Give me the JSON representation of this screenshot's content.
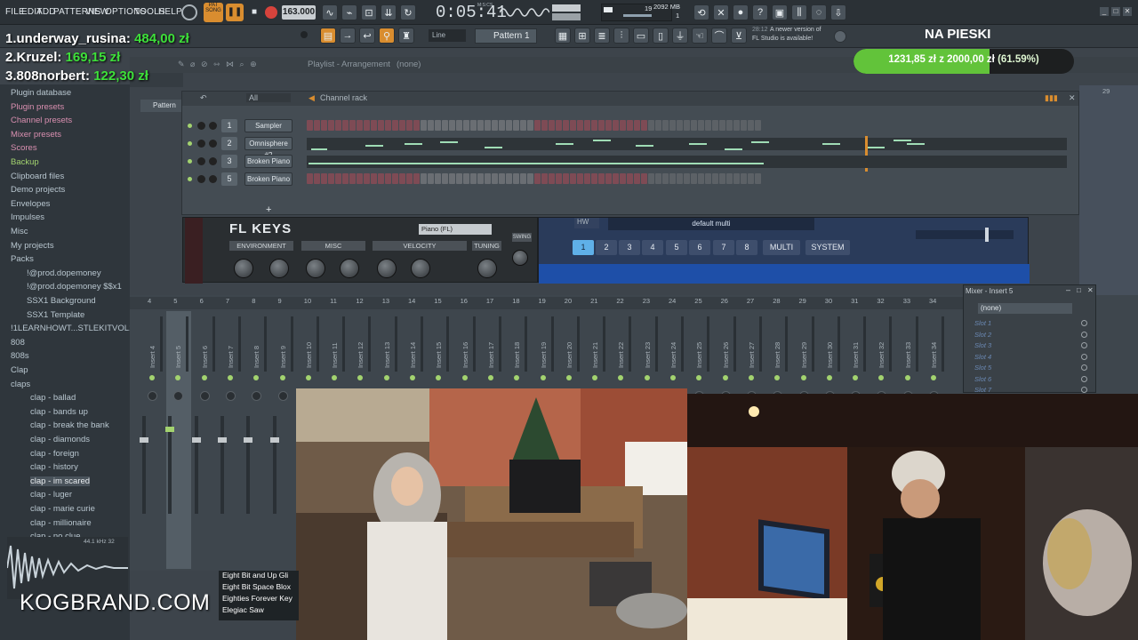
{
  "menu": [
    "FILE",
    "EDIT",
    "ADD",
    "PATTERNS",
    "VIEW",
    "OPTIONS",
    "TOOLS",
    "HELP"
  ],
  "transport": {
    "pat_label": "PAT",
    "song_label": "SONG",
    "tempo": "163.000",
    "time": "0:05:41",
    "time_unit": "M:S:CS",
    "cpu": "19",
    "memory": "2092 MB",
    "voices": "1"
  },
  "toolbar2": {
    "snap": "Line",
    "pattern": "Pattern 1",
    "notice_time": "28:12",
    "notice_text_1": "A newer version of",
    "notice_text_2": "FL Studio is available!"
  },
  "leaderboard": [
    {
      "rank": "1.",
      "name": "underway_rusina:",
      "amount": "484,00 zł"
    },
    {
      "rank": "2.",
      "name": "Kruzel:",
      "amount": "169,15 zł"
    },
    {
      "rank": "3.",
      "name": "808norbert:",
      "amount": "122,30 zł"
    }
  ],
  "goal": {
    "title": "NA PIESKI",
    "current": "1231,85 zł",
    "sep": "z",
    "target": "2000,00 zł",
    "percent_label": "(61.59%)",
    "fill_fraction": 0.6159,
    "fill_color": "#62c33a"
  },
  "playlist": {
    "title": "Playlist - Arrangement",
    "none": "(none)",
    "pattern_tab": "Pattern",
    "bar_number": "29"
  },
  "browser": {
    "items": [
      {
        "label": "Plugin database",
        "style": "normal"
      },
      {
        "label": "Plugin presets",
        "style": "pink"
      },
      {
        "label": "Channel presets",
        "style": "pink"
      },
      {
        "label": "Mixer presets",
        "style": "pink"
      },
      {
        "label": "Scores",
        "style": "pink"
      },
      {
        "label": "Backup",
        "style": "green"
      },
      {
        "label": "Clipboard files",
        "style": "normal"
      },
      {
        "label": "Demo projects",
        "style": "normal"
      },
      {
        "label": "Envelopes",
        "style": "normal"
      },
      {
        "label": "Impulses",
        "style": "normal"
      },
      {
        "label": "Misc",
        "style": "normal"
      },
      {
        "label": "My projects",
        "style": "normal"
      },
      {
        "label": "Packs",
        "style": "normal"
      },
      {
        "label": "!@prod.dopemoney",
        "style": "normal"
      },
      {
        "label": "!@prod.dopemoney $$x1",
        "style": "normal"
      },
      {
        "label": "SSX1 Background",
        "style": "normal"
      },
      {
        "label": "SSX1 Template",
        "style": "normal"
      },
      {
        "label": "!1LEARNHOWT...STLEKITVOL1",
        "style": "normal"
      },
      {
        "label": "808",
        "style": "normal"
      },
      {
        "label": "808s",
        "style": "normal"
      },
      {
        "label": "Clap",
        "style": "normal"
      },
      {
        "label": "claps",
        "style": "normal"
      },
      {
        "label": "clap - ballad",
        "style": "normal"
      },
      {
        "label": "clap - bands up",
        "style": "normal"
      },
      {
        "label": "clap - break the bank",
        "style": "normal"
      },
      {
        "label": "clap - diamonds",
        "style": "normal"
      },
      {
        "label": "clap - foreign",
        "style": "normal"
      },
      {
        "label": "clap - history",
        "style": "normal"
      },
      {
        "label": "clap - im scared",
        "style": "sel"
      },
      {
        "label": "clap - luger",
        "style": "normal"
      },
      {
        "label": "clap - marie curie",
        "style": "normal"
      },
      {
        "label": "clap - millionaire",
        "style": "normal"
      },
      {
        "label": "clap - no clue",
        "style": "normal"
      }
    ],
    "waveform_info": "44.1 kHz 32"
  },
  "channel_rack": {
    "title": "Channel rack",
    "filter": "All",
    "channels": [
      {
        "num": "1",
        "name": "Sampler",
        "mode": "steps"
      },
      {
        "num": "2",
        "name": "Omnisphere #2",
        "mode": "piano"
      },
      {
        "num": "3",
        "name": "Broken Piano",
        "mode": "piano-long"
      },
      {
        "num": "5",
        "name": "Broken Piano",
        "mode": "steps"
      }
    ],
    "add_button": "+"
  },
  "flkeys": {
    "title": "FL KEYS",
    "preset": "Piano (FL)",
    "tabs": [
      "ENVIRONMENT",
      "MISC",
      "VELOCITY",
      "TUNING"
    ],
    "side_tab": "SWING"
  },
  "sampler_plugin": {
    "hw_label": "HW",
    "preset": "default multi",
    "slots": [
      "1",
      "2",
      "3",
      "4",
      "5",
      "6",
      "7",
      "8"
    ],
    "multi": "MULTI",
    "system": "SYSTEM"
  },
  "mixer": {
    "title": "Mixer - Insert 5",
    "routing": "(none)",
    "slots": [
      "Slot 1",
      "Slot 2",
      "Slot 3",
      "Slot 4",
      "Slot 5",
      "Slot 6",
      "Slot 7"
    ],
    "strip_numbers": [
      "4",
      "5",
      "6",
      "7",
      "8",
      "9",
      "10",
      "11",
      "12",
      "13",
      "14",
      "15",
      "16",
      "17",
      "18",
      "19",
      "20",
      "21",
      "22",
      "23",
      "24",
      "25",
      "26",
      "27",
      "28",
      "29",
      "30",
      "31",
      "32",
      "33",
      "34"
    ],
    "strip_labels": [
      "Insert 4",
      "Insert 5",
      "Insert 6",
      "Insert 7",
      "Insert 8",
      "Insert 9",
      "Insert 10",
      "Insert 11",
      "Insert 12",
      "Insert 13",
      "Insert 14",
      "Insert 15",
      "Insert 16",
      "Insert 17",
      "Insert 18",
      "Insert 19",
      "Insert 20",
      "Insert 21",
      "Insert 22",
      "Insert 23",
      "Insert 24",
      "Insert 25",
      "Insert 26",
      "Insert 27",
      "Insert 28",
      "Insert 29",
      "Insert 30",
      "Insert 31",
      "Insert 32",
      "Insert 33",
      "Insert 34"
    ]
  },
  "plugin_list": [
    "Eight Bit and Up Gli",
    "Eight Bit Space Blox",
    "Eighties Forever Key",
    "Elegiac Saw"
  ],
  "brand": "KOGBRAND.COM"
}
